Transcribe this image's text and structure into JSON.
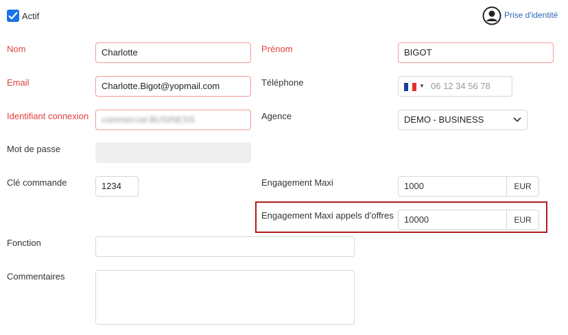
{
  "header": {
    "active_label": "Actif",
    "active_checked": true,
    "impersonate_label": "Prise d'identité"
  },
  "form": {
    "nom": {
      "label": "Nom",
      "value": "Charlotte"
    },
    "prenom": {
      "label": "Prénom",
      "value": "BIGOT"
    },
    "email": {
      "label": "Email",
      "value": "Charlotte.Bigot@yopmail.com"
    },
    "telephone": {
      "label": "Téléphone",
      "placeholder": "06 12 34 56 78",
      "country": "FR"
    },
    "identifiant": {
      "label": "Identifiant connexion",
      "value": "commercial.BUSINESS"
    },
    "agence": {
      "label": "Agence",
      "value": "DEMO - BUSINESS"
    },
    "mot_de_passe": {
      "label": "Mot de passe",
      "value": ""
    },
    "cle_commande": {
      "label": "Clé commande",
      "value": "1234"
    },
    "engagement_maxi": {
      "label": "Engagement Maxi",
      "value": "1000",
      "currency": "EUR"
    },
    "engagement_maxi_ao": {
      "label": "Engagement Maxi appels d’offres",
      "value": "10000",
      "currency": "EUR"
    },
    "fonction": {
      "label": "Fonction",
      "value": ""
    },
    "commentaires": {
      "label": "Commentaires",
      "value": ""
    }
  },
  "colors": {
    "required_label": "#e0413c",
    "checkbox": "#1a73e8",
    "link": "#2a66b6",
    "highlight_border": "#b01c1c"
  }
}
